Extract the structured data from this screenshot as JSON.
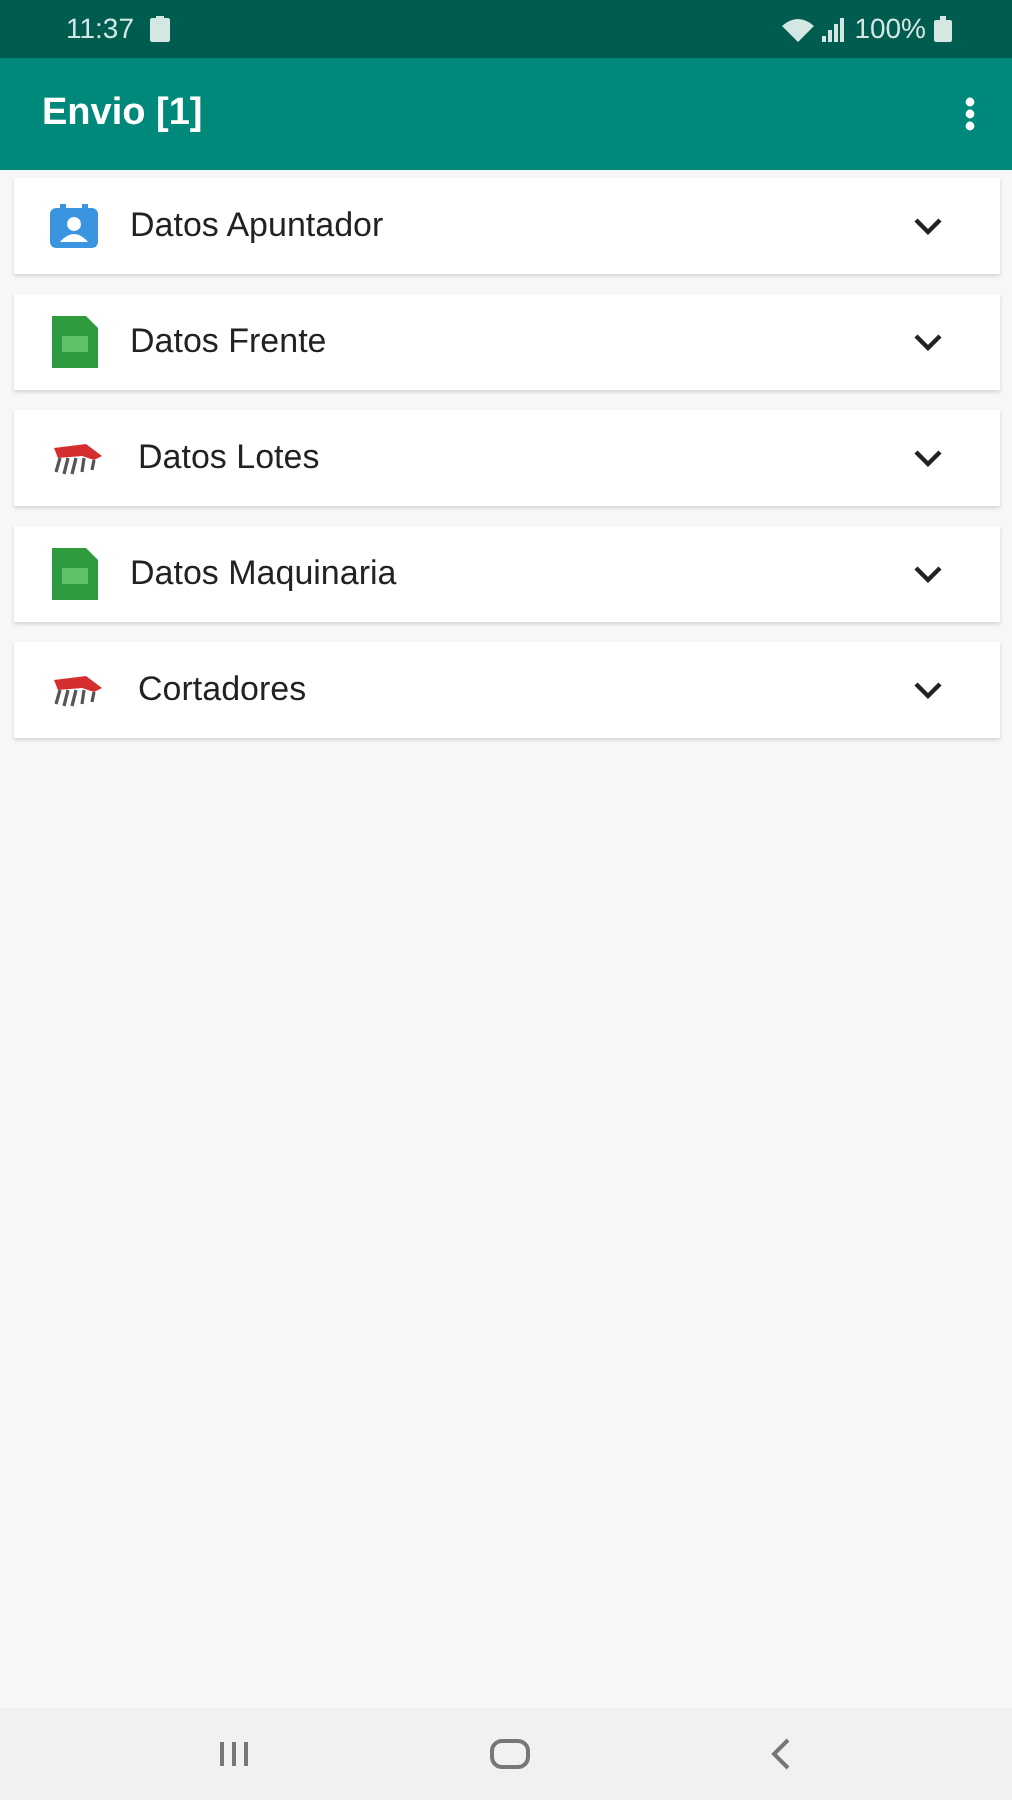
{
  "status_bar": {
    "time": "11:37",
    "battery": "100%"
  },
  "app_bar": {
    "title": "Envio [1]"
  },
  "sections": [
    {
      "kind": "contact",
      "label": "Datos Apuntador",
      "expanded": false
    },
    {
      "kind": "sheet",
      "label": "Datos Frente",
      "expanded": false
    },
    {
      "kind": "machine",
      "label": "Datos Lotes",
      "expanded": false
    },
    {
      "kind": "sheet",
      "label": "Datos Maquinaria",
      "expanded": false
    },
    {
      "kind": "machine",
      "label": "Cortadores",
      "expanded": false
    }
  ]
}
